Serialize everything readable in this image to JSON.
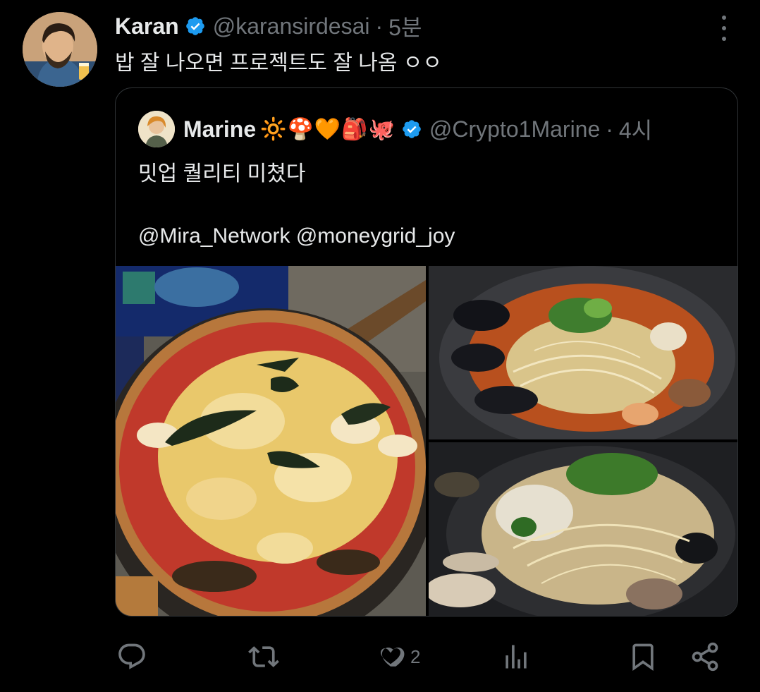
{
  "tweet": {
    "author_name": "Karan",
    "author_handle": "@karansirdesai",
    "separator": "·",
    "time": "5분",
    "text": "밥 잘 나오면 프로젝트도 잘 나옴 ㅇㅇ"
  },
  "quoted": {
    "author_name": "Marine",
    "author_emojis": "🔆🍄🧡🎒🐙",
    "author_handle": "@Crypto1Marine",
    "separator": "·",
    "time": "4시",
    "text_line1": "밋업 퀄리티 미쳤다",
    "text_line2": "@Mira_Network @moneygrid_joy"
  },
  "actions": {
    "reply_icon": "reply-icon",
    "retweet_icon": "retweet-icon",
    "like_icon": "heart-icon",
    "like_count": "2",
    "views_icon": "analytics-icon",
    "bookmark_icon": "bookmark-icon",
    "share_icon": "share-icon"
  },
  "colors": {
    "background": "#000000",
    "text": "#e7e9ea",
    "secondary": "#71767b",
    "verified": "#1d9bf0",
    "border": "#2f3336"
  }
}
